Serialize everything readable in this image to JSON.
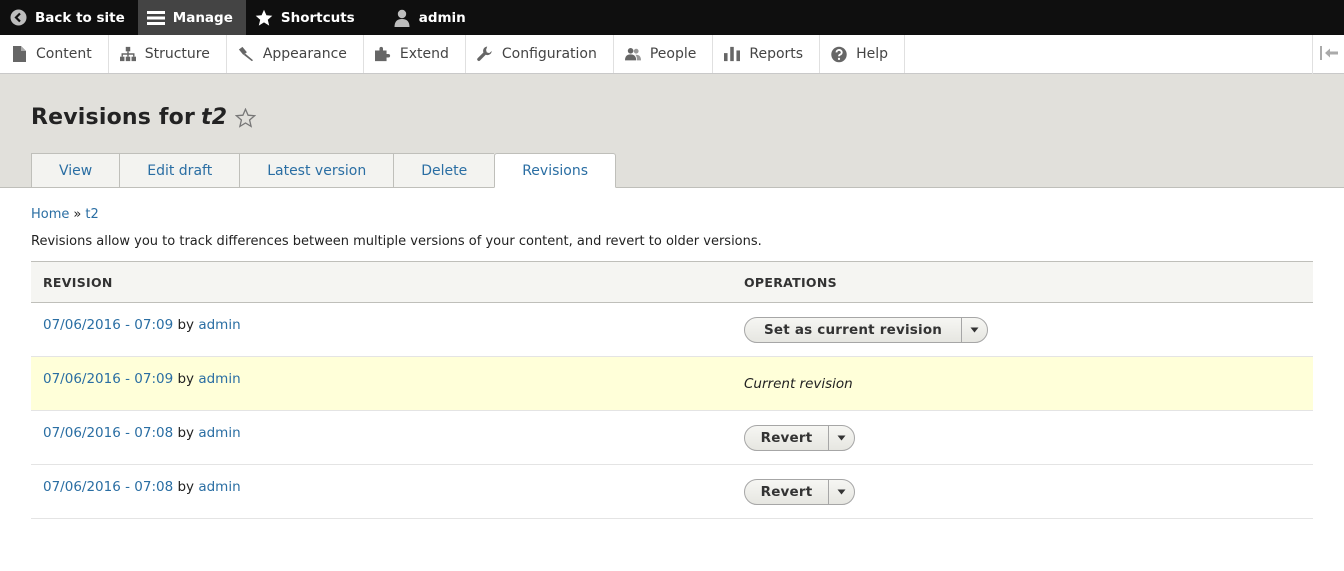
{
  "toolbar": {
    "back": "Back to site",
    "manage": "Manage",
    "shortcuts": "Shortcuts",
    "user": "admin"
  },
  "tray": {
    "items": [
      "Content",
      "Structure",
      "Appearance",
      "Extend",
      "Configuration",
      "People",
      "Reports",
      "Help"
    ]
  },
  "header": {
    "title_prefix": "Revisions for",
    "title_node": "t2",
    "tabs": [
      "View",
      "Edit draft",
      "Latest version",
      "Delete",
      "Revisions"
    ],
    "active_tab": "Revisions"
  },
  "breadcrumb": {
    "home": "Home",
    "separator": "»",
    "current": "t2"
  },
  "help_text": "Revisions allow you to track differences between multiple versions of your content, and revert to older versions.",
  "table": {
    "headers": [
      "REVISION",
      "OPERATIONS"
    ],
    "rows": [
      {
        "date": "07/06/2016 - 07:09",
        "by": "by",
        "author": "admin",
        "operation": "Set as current revision"
      },
      {
        "date": "07/06/2016 - 07:09",
        "by": "by",
        "author": "admin",
        "operation": "Current revision"
      },
      {
        "date": "07/06/2016 - 07:08",
        "by": "by",
        "author": "admin",
        "operation": "Revert"
      },
      {
        "date": "07/06/2016 - 07:08",
        "by": "by",
        "author": "admin",
        "operation": "Revert"
      }
    ]
  },
  "colors": {
    "toolbar": "#0f0f0f",
    "link": "#2a6ea3",
    "header_bg": "#e1e0db",
    "current_row": "#ffffd9"
  }
}
